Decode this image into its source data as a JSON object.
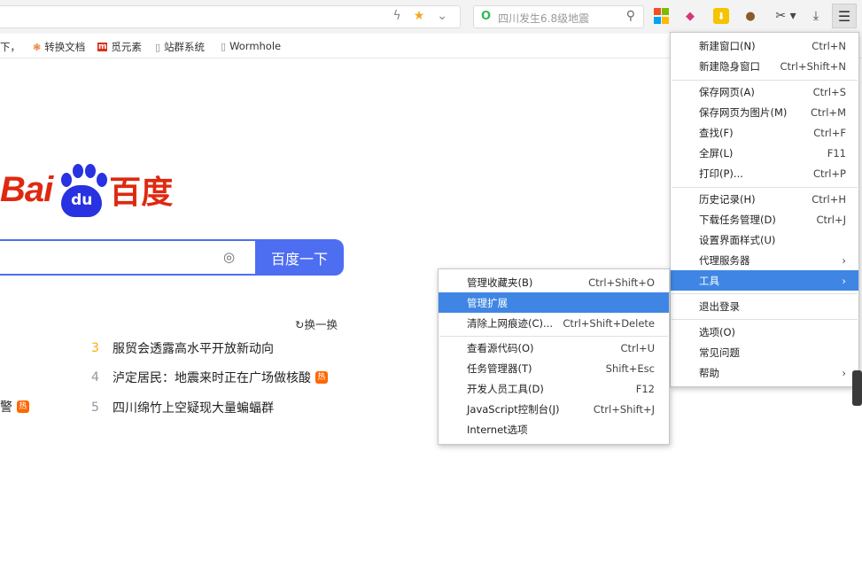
{
  "colors": {
    "accent": "#4e6ef2",
    "menu_highlight": "#3f86e4",
    "baidu_red": "#de2910",
    "baidu_blue": "#2932e1",
    "hot_orange": "#ff6600"
  },
  "toolbar": {
    "search_placeholder": "四川发生6.8级地震",
    "icons": [
      "lightning-icon",
      "star-icon",
      "chevron-down-icon",
      "search-icon",
      "apps-icon",
      "diamond-icon",
      "download-box-icon",
      "cookie-icon",
      "scissors-icon",
      "download-icon",
      "menu-icon"
    ]
  },
  "bookmarks": [
    {
      "label": "下，",
      "icon": ""
    },
    {
      "label": "转换文档",
      "icon": "convert-icon"
    },
    {
      "label": "觅元素",
      "icon": "m-logo-icon"
    },
    {
      "label": "站群系统",
      "icon": "page-icon"
    },
    {
      "label": "Wormhole",
      "icon": "page-icon"
    }
  ],
  "baidu": {
    "logo_text": "Bai",
    "logo_paw_text": "du",
    "logo_cn": "百度",
    "search_button": "百度一下",
    "refresh_label": "换一换",
    "hot_icon": "热",
    "hot_list": [
      {
        "rank": "3",
        "title": "服贸会透露高水平开放新动向",
        "hot": false
      },
      {
        "rank": "4",
        "title": "泸定居民：地震来时正在广场做核酸",
        "hot": true
      },
      {
        "rank": "5",
        "title": "四川绵竹上空疑现大量蝙蝠群",
        "hot": false
      }
    ],
    "left_cut_text": "警"
  },
  "main_menu": [
    {
      "label": "新建窗口(N)",
      "shortcut": "Ctrl+N"
    },
    {
      "label": "新建隐身窗口",
      "shortcut": "Ctrl+Shift+N"
    },
    {
      "label": "保存网页(A)",
      "shortcut": "Ctrl+S"
    },
    {
      "label": "保存网页为图片(M)",
      "shortcut": "Ctrl+M"
    },
    {
      "label": "查找(F)",
      "shortcut": "Ctrl+F"
    },
    {
      "label": "全屏(L)",
      "shortcut": "F11"
    },
    {
      "label": "打印(P)...",
      "shortcut": "Ctrl+P"
    },
    {
      "label": "历史记录(H)",
      "shortcut": "Ctrl+H"
    },
    {
      "label": "下载任务管理(D)",
      "shortcut": "Ctrl+J"
    },
    {
      "label": "设置界面样式(U)",
      "shortcut": ""
    },
    {
      "label": "代理服务器",
      "shortcut": "›"
    },
    {
      "label": "工具",
      "shortcut": "›"
    },
    {
      "label": "退出登录",
      "shortcut": ""
    },
    {
      "label": "选项(O)",
      "shortcut": ""
    },
    {
      "label": "常见问题",
      "shortcut": ""
    },
    {
      "label": "帮助",
      "shortcut": "›"
    }
  ],
  "tools_submenu": [
    {
      "label": "管理收藏夹(B)",
      "shortcut": "Ctrl+Shift+O"
    },
    {
      "label": "管理扩展",
      "shortcut": ""
    },
    {
      "label": "清除上网痕迹(C)...",
      "shortcut": "Ctrl+Shift+Delete"
    },
    {
      "label": "查看源代码(O)",
      "shortcut": "Ctrl+U"
    },
    {
      "label": "任务管理器(T)",
      "shortcut": "Shift+Esc"
    },
    {
      "label": "开发人员工具(D)",
      "shortcut": "F12"
    },
    {
      "label": "JavaScript控制台(J)",
      "shortcut": "Ctrl+Shift+J"
    },
    {
      "label": "Internet选项",
      "shortcut": ""
    }
  ]
}
